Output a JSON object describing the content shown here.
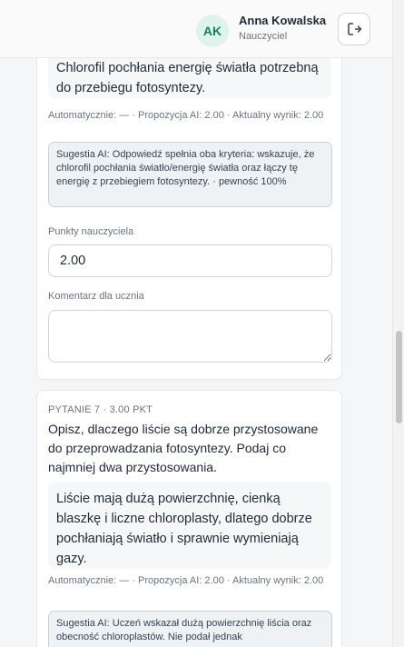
{
  "header": {
    "ghost_text": "",
    "avatar_initials": "AK",
    "user_name": "Anna Kowalska",
    "user_role": "Nauczyciel",
    "logout_icon": "logout-icon"
  },
  "question_6": {
    "answer": "Chlorofil pochłania energię światła potrzebną do przebiegu fotosyntezy.",
    "meta": "Automatycznie: — · Propozycja AI: 2.00 · Aktualny wynik: 2.00",
    "suggestion": "Sugestia AI: Odpowiedź spełnia oba kryteria: wskazuje, że chlorofil pochłania światło/energię światła oraz łączy tę energię z przebiegiem fotosyntezy. · pewność 100%",
    "points_label": "Punkty nauczyciela",
    "points_value": "2.00",
    "comment_label": "Komentarz dla ucznia",
    "comment_value": ""
  },
  "question_7": {
    "header": "PYTANIE 7 · 3.00 PKT",
    "text": "Opisz, dlaczego liście są dobrze przystosowane do przeprowadzania fotosyntezy. Podaj co najmniej dwa przystosowania.",
    "answer": "Liście mają dużą powierzchnię, cienką blaszkę i liczne chloroplasty, dlatego dobrze pochłaniają światło i sprawnie wymieniają gazy.",
    "meta": "Automatycznie: — · Propozycja AI: 2.00 · Aktualny wynik: 2.00",
    "suggestion": "Sugestia AI: Uczeń wskazał dużą powierzchnię liścia oraz obecność chloroplastów. Nie podał jednak"
  }
}
